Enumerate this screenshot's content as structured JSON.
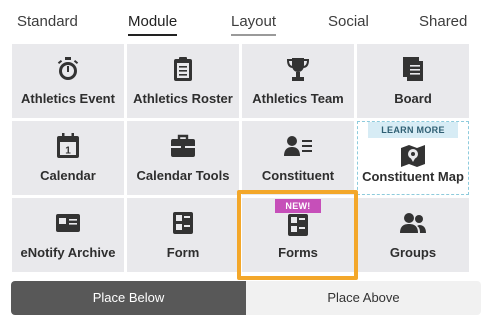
{
  "tabs": [
    {
      "label": "Standard",
      "state": "normal"
    },
    {
      "label": "Module",
      "state": "active"
    },
    {
      "label": "Layout",
      "state": "hover"
    },
    {
      "label": "Social",
      "state": "normal"
    },
    {
      "label": "Shared",
      "state": "normal"
    }
  ],
  "tiles": [
    {
      "label": "Athletics Event",
      "icon": "stopwatch-icon"
    },
    {
      "label": "Athletics Roster",
      "icon": "clipboard-icon"
    },
    {
      "label": "Athletics Team",
      "icon": "trophy-icon"
    },
    {
      "label": "Board",
      "icon": "stacked-documents-icon"
    },
    {
      "label": "Calendar",
      "icon": "calendar-icon",
      "icon_text": "1"
    },
    {
      "label": "Calendar Tools",
      "icon": "toolbox-icon"
    },
    {
      "label": "Constituent",
      "icon": "person-list-icon"
    },
    {
      "label": "Constituent Map",
      "icon": "map-pin-icon",
      "badge": "LEARN MORE"
    },
    {
      "label": "eNotify Archive",
      "icon": "email-archive-icon"
    },
    {
      "label": "Form",
      "icon": "form-icon"
    },
    {
      "label": "Forms",
      "icon": "form-icon",
      "badge": "NEW!"
    },
    {
      "label": "Groups",
      "icon": "group-icon"
    }
  ],
  "buttons": {
    "place_below": "Place Below",
    "place_above": "Place Above"
  },
  "colors": {
    "tile_bg": "#e9e9ec",
    "new_badge": "#c64fb9",
    "learn_badge": "#d7ecf5",
    "highlight": "#f3a72a",
    "place_below_bg": "#585858"
  }
}
